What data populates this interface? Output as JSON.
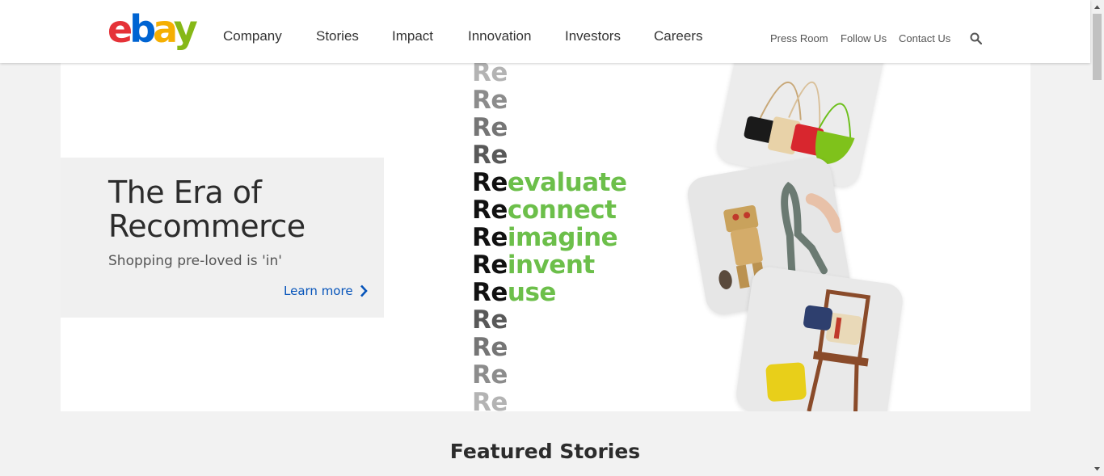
{
  "logo": {
    "letters": [
      "e",
      "b",
      "a",
      "y"
    ]
  },
  "nav": {
    "main": [
      "Company",
      "Stories",
      "Impact",
      "Innovation",
      "Investors",
      "Careers"
    ],
    "utility": [
      "Press Room",
      "Follow Us",
      "Contact Us"
    ]
  },
  "hero": {
    "title": "The Era of Recommerce",
    "subtitle": "Shopping pre-loved is 'in'",
    "cta": "Learn more",
    "re_lines": [
      {
        "pre": "Re",
        "suf": ""
      },
      {
        "pre": "Re",
        "suf": ""
      },
      {
        "pre": "Re",
        "suf": ""
      },
      {
        "pre": "Re",
        "suf": ""
      },
      {
        "pre": "Re",
        "suf": "evaluate"
      },
      {
        "pre": "Re",
        "suf": "connect"
      },
      {
        "pre": "Re",
        "suf": "imagine"
      },
      {
        "pre": "Re",
        "suf": "invent"
      },
      {
        "pre": "Re",
        "suf": "use"
      },
      {
        "pre": "Re",
        "suf": ""
      },
      {
        "pre": "Re",
        "suf": ""
      },
      {
        "pre": "Re",
        "suf": ""
      },
      {
        "pre": "Re",
        "suf": ""
      }
    ],
    "re_gray_colors": [
      "#b3b3b3",
      "#8c8c8c",
      "#757575",
      "#595959",
      "",
      "",
      "",
      "",
      "",
      "#595959",
      "#757575",
      "#8c8c8c",
      "#b3b3b3"
    ]
  },
  "featured": {
    "title": "Featured Stories"
  },
  "colors": {
    "link": "#0654ba",
    "green": "#6cbf4a"
  }
}
